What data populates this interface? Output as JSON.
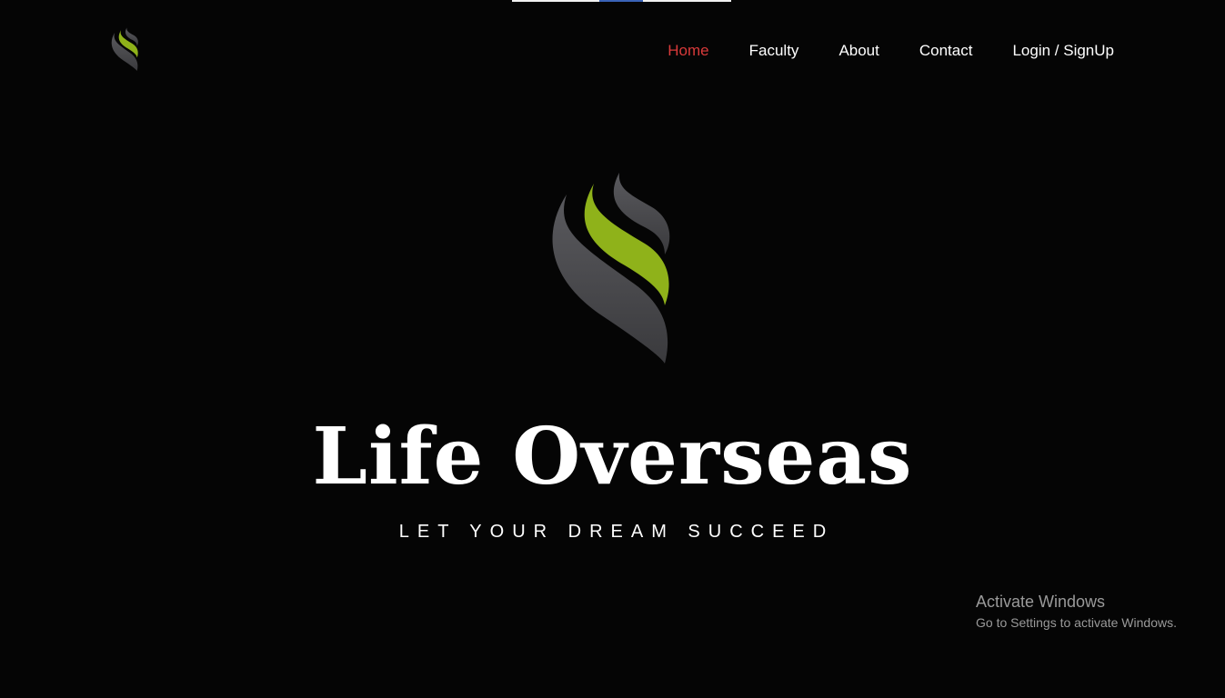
{
  "nav": {
    "items": [
      {
        "label": "Home",
        "active": true
      },
      {
        "label": "Faculty",
        "active": false
      },
      {
        "label": "About",
        "active": false
      },
      {
        "label": "Contact",
        "active": false
      },
      {
        "label": "Login / SignUp",
        "active": false
      }
    ]
  },
  "hero": {
    "title": "Life Overseas",
    "tagline": "LET YOUR DREAM SUCCEED"
  },
  "watermark": {
    "title": "Activate Windows",
    "subtitle": "Go to Settings to activate Windows."
  },
  "colors": {
    "background": "#050505",
    "nav_active": "#d93a3a",
    "logo_green": "#8fb21a",
    "logo_gray": "#4a4a4d"
  },
  "icons": {
    "nav_logo": "flame-swoosh-logo",
    "hero_logo": "flame-swoosh-logo"
  }
}
